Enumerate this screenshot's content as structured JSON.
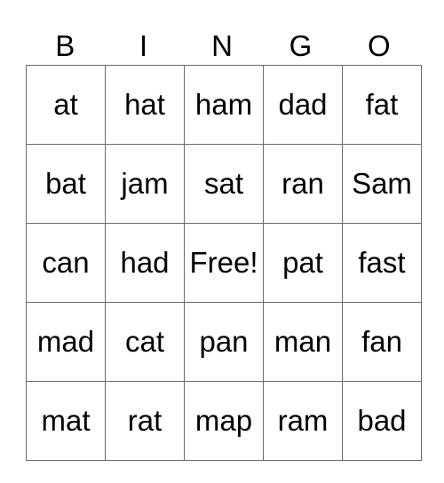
{
  "header": [
    "B",
    "I",
    "N",
    "G",
    "O"
  ],
  "rows": [
    [
      "at",
      "hat",
      "ham",
      "dad",
      "fat"
    ],
    [
      "bat",
      "jam",
      "sat",
      "ran",
      "Sam"
    ],
    [
      "can",
      "had",
      "Free!",
      "pat",
      "fast"
    ],
    [
      "mad",
      "cat",
      "pan",
      "man",
      "fan"
    ],
    [
      "mat",
      "rat",
      "map",
      "ram",
      "bad"
    ]
  ]
}
